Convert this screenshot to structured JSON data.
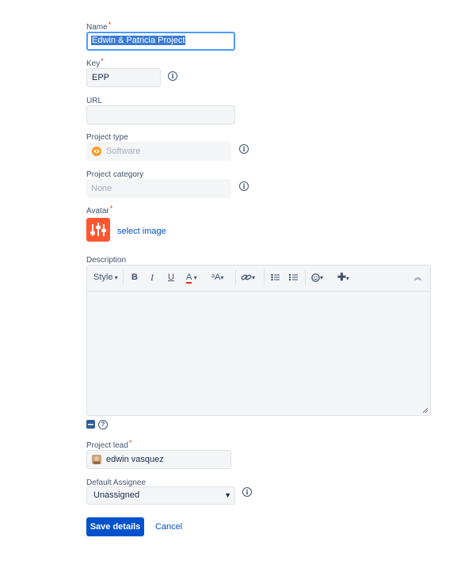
{
  "form": {
    "name": {
      "label": "Name",
      "value": "Edwin & Patricia Project"
    },
    "key": {
      "label": "Key",
      "value": "EPP"
    },
    "url": {
      "label": "URL",
      "value": ""
    },
    "project_type": {
      "label": "Project type",
      "value": "Software"
    },
    "project_category": {
      "label": "Project category",
      "value": "None"
    },
    "avatar": {
      "label": "Avatar",
      "link": "select image"
    },
    "description": {
      "label": "Description",
      "toolbar": {
        "style": "Style",
        "bold": "B",
        "italic": "I",
        "underline": "U",
        "text_color": "A",
        "text_effects": "ᵃA"
      },
      "value": ""
    },
    "project_lead": {
      "label": "Project lead",
      "value": "edwin vasquez"
    },
    "default_assignee": {
      "label": "Default Assignee",
      "value": "Unassigned",
      "options": [
        "Unassigned"
      ]
    }
  },
  "actions": {
    "save": "Save details",
    "cancel": "Cancel"
  },
  "required_marker": "*",
  "colors": {
    "primary": "#0052cc",
    "link": "#0052cc",
    "required": "#de350b",
    "avatar_bg": "#ff5630",
    "focus_border": "#4c9aff"
  }
}
